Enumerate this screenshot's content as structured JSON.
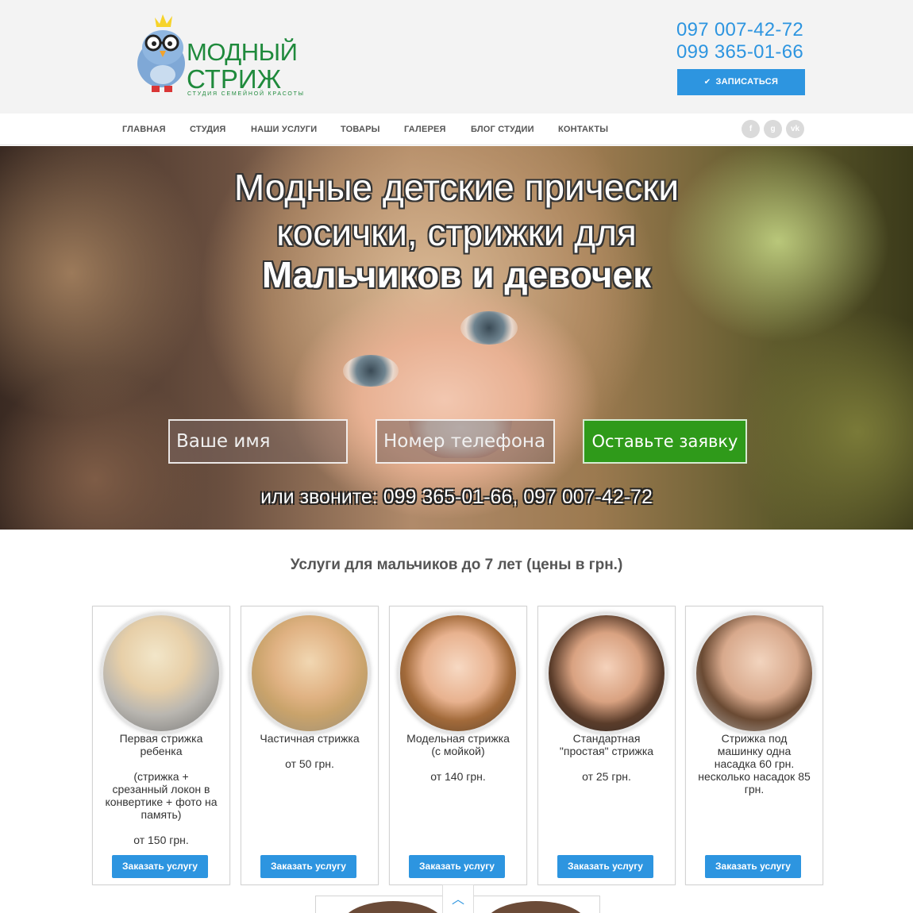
{
  "header": {
    "logo_line1": "МОДНЫЙ",
    "logo_line2": "СТРИЖ",
    "logo_tagline": "СТУДИЯ СЕМЕЙНОЙ КРАСОТЫ",
    "phone1": "097 007-42-72",
    "phone2": "099 365-01-66",
    "signup_label": "ЗАПИСАТЬСЯ",
    "signup_icon": "check-icon"
  },
  "nav": {
    "items": [
      "ГЛАВНАЯ",
      "СТУДИЯ",
      "НАШИ УСЛУГИ",
      "ТОВАРЫ",
      "ГАЛЕРЕЯ",
      "БЛОГ СТУДИИ",
      "КОНТАКТЫ"
    ],
    "social": [
      "f",
      "g",
      "vk"
    ]
  },
  "hero": {
    "title_line1": "Модные детские прически",
    "title_line2": "косички, стрижки для",
    "title_line3": "Мальчиков и девочек",
    "name_placeholder": "Ваше имя",
    "phone_placeholder": "Номер телефона",
    "submit_label": "Оставьте заявку",
    "call_text": "или звоните: 099 365-01-66, 097 007-42-72"
  },
  "services": {
    "title": "Услуги для мальчиков до 7 лет (цены в грн.)",
    "order_label": "Заказать услугу",
    "cards": [
      {
        "lines": [
          "Первая стрижка",
          "ребенка",
          "",
          "(стрижка +",
          "срезанный локон в",
          "конвертике + фото на",
          "память)",
          "",
          "от 150 грн."
        ]
      },
      {
        "lines": [
          "Частичная стрижка",
          "",
          "от 50 грн."
        ]
      },
      {
        "lines": [
          "Модельная стрижка",
          "(с мойкой)",
          "",
          "от 140 грн."
        ]
      },
      {
        "lines": [
          "Стандартная",
          "\"простая\" стрижка",
          "",
          "от 25 грн."
        ]
      },
      {
        "lines": [
          "Стрижка под",
          "машинку одна",
          "насадка 60 грн.",
          "несколько насадок 85",
          "грн."
        ]
      }
    ]
  },
  "colors": {
    "accent": "#2d95e0",
    "brand_green": "#1f8a3c",
    "submit_green": "#2f9a1a"
  }
}
